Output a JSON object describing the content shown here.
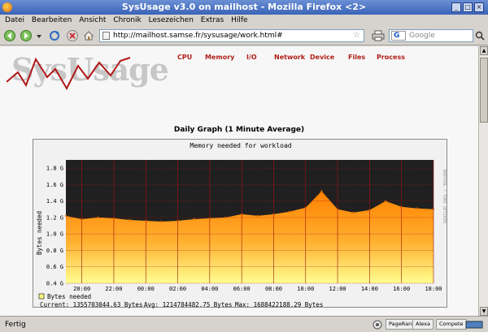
{
  "window": {
    "title": "SysUsage v3.0 on mailhost - Mozilla Firefox <2>"
  },
  "menu": [
    "Datei",
    "Bearbeiten",
    "Ansicht",
    "Chronik",
    "Lesezeichen",
    "Extras",
    "Hilfe"
  ],
  "address": {
    "url": "http://mailhost.samse.fr/sysusage/work.html#"
  },
  "search": {
    "placeholder": "Google",
    "engine_icon": "G"
  },
  "page": {
    "logo": "SysUsage",
    "nav": [
      "CPU",
      "Memory",
      "I/O",
      "Network",
      "Device",
      "Files",
      "Process"
    ],
    "graph_caption": "Daily Graph (1 Minute Average)"
  },
  "chart_data": {
    "type": "area",
    "title": "Memory needed for workload",
    "ylabel": "Bytes needed",
    "y_ticks": [
      "0.4 G",
      "0.6 G",
      "0.8 G",
      "1.0 G",
      "1.2 G",
      "1.4 G",
      "1.6 G",
      "1.8 G"
    ],
    "ylim": [
      0.4,
      1.9
    ],
    "x_ticks": [
      "20:00",
      "22:00",
      "00:00",
      "02:00",
      "04:00",
      "06:00",
      "08:00",
      "10:00",
      "12:00",
      "14:00",
      "16:00",
      "18:00"
    ],
    "series": [
      {
        "name": "Bytes needed",
        "color": "#ffa020",
        "x": [
          "19:00",
          "20:00",
          "21:00",
          "22:00",
          "23:00",
          "00:00",
          "01:00",
          "02:00",
          "03:00",
          "04:00",
          "05:00",
          "06:00",
          "07:00",
          "08:00",
          "09:00",
          "10:00",
          "11:00",
          "12:00",
          "13:00",
          "14:00",
          "15:00",
          "16:00",
          "17:00",
          "18:00"
        ],
        "values": [
          1.22,
          1.18,
          1.2,
          1.19,
          1.17,
          1.16,
          1.15,
          1.16,
          1.18,
          1.19,
          1.2,
          1.24,
          1.22,
          1.24,
          1.27,
          1.32,
          1.52,
          1.3,
          1.26,
          1.29,
          1.4,
          1.33,
          1.31,
          1.3
        ]
      }
    ],
    "stats": {
      "current": "Current: 1355703044.63 Bytes",
      "avg": "Avg: 1214784482.75 Bytes",
      "max": "Max: 1688422188.29 Bytes"
    },
    "watermark": "RRDTOOL / TOBI OETIKER",
    "grid": true,
    "legend": "bottom-left"
  },
  "statusbar": {
    "text": "Fertig",
    "widgets": [
      "PageRank",
      "Alexa",
      "Compete"
    ]
  },
  "colors": {
    "chart_bg": "#202020",
    "fill_top": "#ff8c00",
    "fill_bottom": "#ffff80",
    "grid": "#a01010",
    "nav": "#b0201a"
  }
}
